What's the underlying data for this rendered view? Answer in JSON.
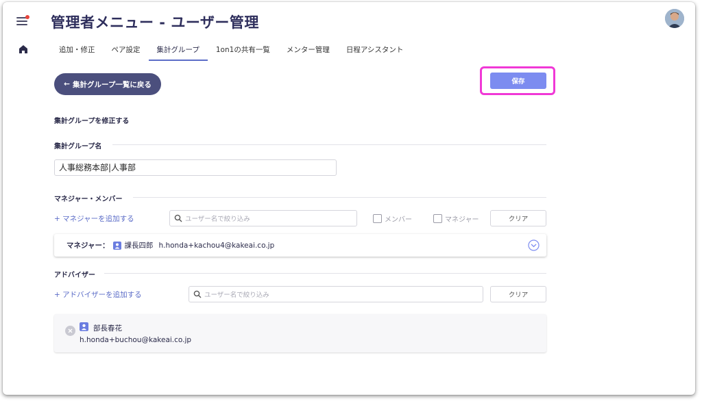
{
  "header": {
    "title": "管理者メニュー - ユーザー管理"
  },
  "tabs": [
    {
      "label": "追加・修正"
    },
    {
      "label": "ペア設定"
    },
    {
      "label": "集計グループ"
    },
    {
      "label": "1on1の共有一覧"
    },
    {
      "label": "メンター管理"
    },
    {
      "label": "日程アシスタント"
    }
  ],
  "active_tab": "集計グループ",
  "back_button": {
    "label": "集計グループ一覧に戻る"
  },
  "save_button": {
    "label": "保存"
  },
  "form": {
    "heading": "集計グループを修正する",
    "group_name_section": "集計グループ名",
    "group_name_value": "人事総務本部|人事部"
  },
  "managers_members": {
    "section_title": "マネジャー・メンバー",
    "add_link": "+ マネジャーを追加する",
    "search_placeholder": "ユーザー名で絞り込み",
    "checkbox_member": "メンバー",
    "checkbox_manager": "マネジャー",
    "clear": "クリア",
    "manager_label": "マネジャー：",
    "manager_name": "課長四郎",
    "manager_email": "h.honda+kachou4@kakeai.co.jp"
  },
  "advisors": {
    "section_title": "アドバイザー",
    "add_link": "+ アドバイザーを追加する",
    "search_placeholder": "ユーザー名で絞り込み",
    "clear": "クリア",
    "items": [
      {
        "name": "部長春花",
        "email": "h.honda+buchou@kakeai.co.jp"
      }
    ]
  },
  "colors": {
    "accent": "#5b6cc7",
    "save": "#7c8cf0",
    "back": "#4b4f7d",
    "highlight": "#f038d6"
  }
}
